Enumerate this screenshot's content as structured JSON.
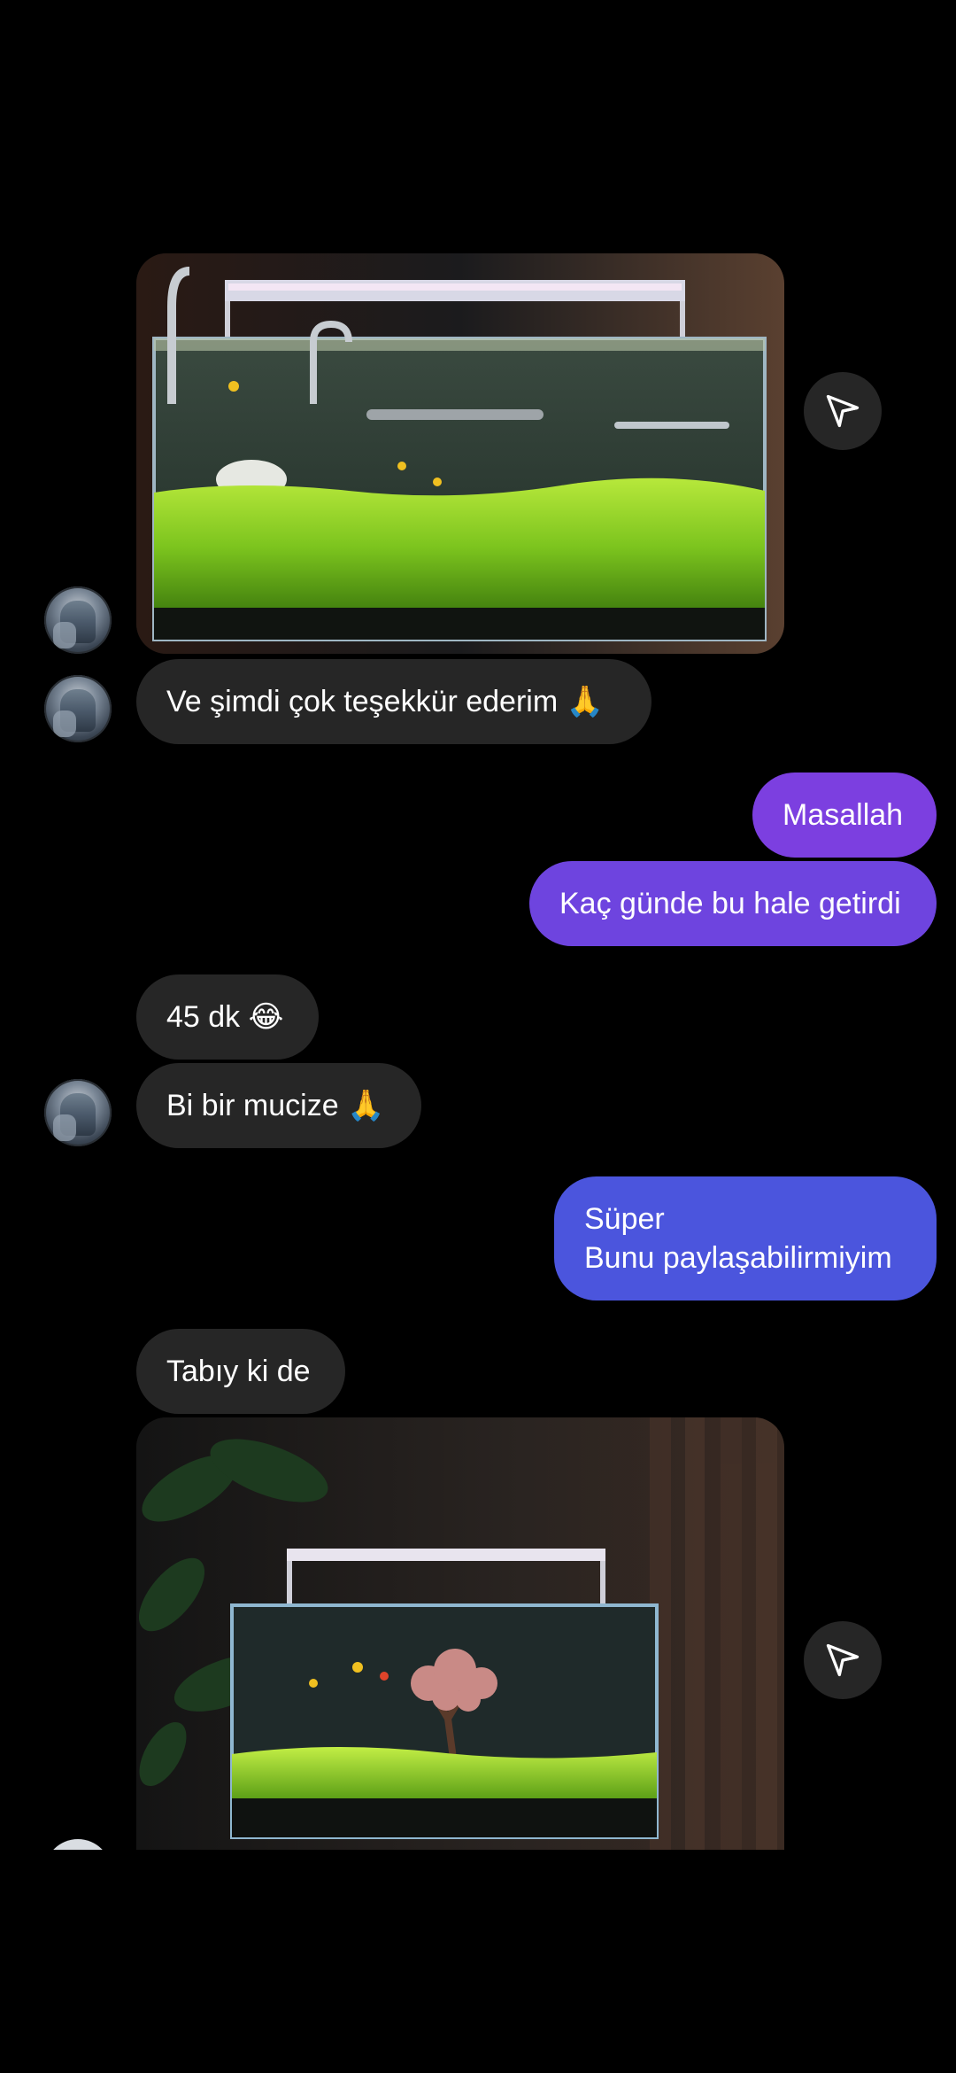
{
  "conversation": {
    "messages": [
      {
        "id": "m1",
        "direction": "incoming",
        "type": "image",
        "alt": "aquarium-photo-1"
      },
      {
        "id": "m2",
        "direction": "incoming",
        "type": "text",
        "text": "Ve şimdi çok teşekkür ederim 🙏"
      },
      {
        "id": "m3",
        "direction": "outgoing",
        "type": "text",
        "text": "Masallah"
      },
      {
        "id": "m4",
        "direction": "outgoing",
        "type": "text",
        "text": "Kaç günde bu hale getirdi"
      },
      {
        "id": "m5",
        "direction": "incoming",
        "type": "text",
        "text": "45 dk 😂"
      },
      {
        "id": "m6",
        "direction": "incoming",
        "type": "text",
        "text": "Bi bir mucize 🙏"
      },
      {
        "id": "m7",
        "direction": "outgoing",
        "type": "text",
        "text": "Süper\nBunu paylaşabilirmiyim"
      },
      {
        "id": "m8",
        "direction": "incoming",
        "type": "text",
        "text": "Tabıy ki de"
      },
      {
        "id": "m9",
        "direction": "incoming",
        "type": "image",
        "alt": "aquarium-photo-2"
      }
    ]
  },
  "icons": {
    "share": "paper-plane-icon",
    "avatar": "contact-avatar"
  },
  "colors": {
    "background": "#000000",
    "incoming_bubble": "#262626",
    "outgoing_purple": "#7a3ee0",
    "outgoing_indigo": "#4b55dd",
    "share_button": "#262626"
  }
}
